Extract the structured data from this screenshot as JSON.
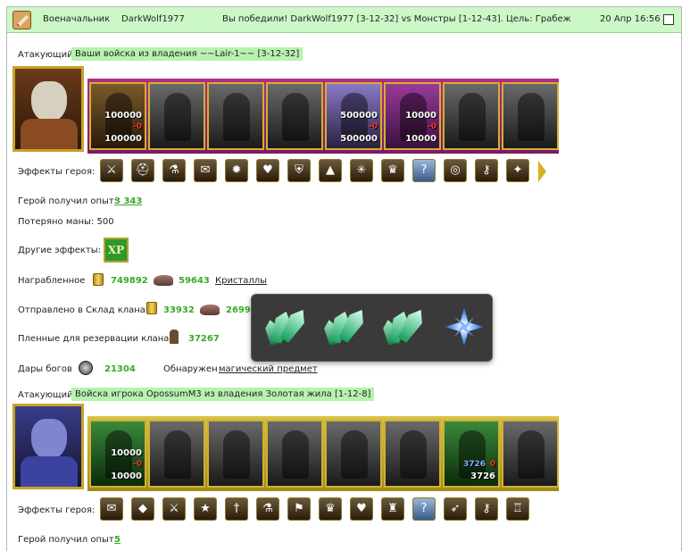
{
  "header": {
    "role": "Военачальник",
    "player": "DarkWolf1977",
    "battle_text": "Вы победили! DarkWolf1977 [3-12-32] vs Монстры [1-12-43]. Цель: Грабеж",
    "datetime": "20 Апр 16:56"
  },
  "section1": {
    "attacker_label": "Атакующий",
    "army_title": "Ваши войска из владения ~~Lair-1~~ [3-12-32]",
    "units": [
      {
        "start": "100000",
        "loss": "-0",
        "end": "100000"
      },
      {
        "start": "",
        "loss": "",
        "end": ""
      },
      {
        "start": "",
        "loss": "",
        "end": ""
      },
      {
        "start": "",
        "loss": "",
        "end": ""
      },
      {
        "start": "500000",
        "loss": "-0",
        "end": "500000"
      },
      {
        "start": "10000",
        "loss": "-0",
        "end": "10000"
      },
      {
        "start": "",
        "loss": "",
        "end": ""
      },
      {
        "start": "",
        "loss": "",
        "end": ""
      }
    ],
    "effects_label": "Эффекты героя:",
    "effects": [
      "sword-icon",
      "helmet-icon",
      "potion-icon",
      "scroll-icon",
      "fire-icon",
      "heart-icon",
      "shield-icon",
      "tent-icon",
      "web-icon",
      "crown-icon",
      "question-icon",
      "ring-icon",
      "key-icon",
      "wand-icon"
    ],
    "exp_label": "Герой получил опыт:",
    "exp_value": "3 343",
    "mana_text": "Потеряно маны: 500",
    "other_effects_label": "Другие эффекты:",
    "xp_badge": "XP",
    "loot_label": "Награбленное",
    "loot_gold": "749892",
    "loot_ore": "59643",
    "loot_link": "Кристаллы",
    "clan_label": "Отправлено в Склад клана",
    "clan_gold": "33932",
    "clan_ore": "2699",
    "prisoners_label": "Пленные для резервации клана:",
    "prisoners_value": "37267",
    "gods_label": "Дары богов",
    "gods_value": "21304",
    "found_label": "Обнаружен",
    "found_link": "магический предмет"
  },
  "section2": {
    "attacker_label": "Атакующий",
    "army_title": "Войска игрока OpossumM3 из владения Золотая жила [1-12-8]",
    "units": [
      {
        "start": "10000",
        "loss": "-0",
        "end": "10000",
        "cur": ""
      },
      {
        "start": "",
        "loss": "",
        "end": "",
        "cur": ""
      },
      {
        "start": "",
        "loss": "",
        "end": "",
        "cur": ""
      },
      {
        "start": "",
        "loss": "",
        "end": "",
        "cur": ""
      },
      {
        "start": "",
        "loss": "",
        "end": "",
        "cur": ""
      },
      {
        "start": "",
        "loss": "",
        "end": "",
        "cur": ""
      },
      {
        "start": "",
        "loss": "0",
        "end": "3726",
        "cur": "3726"
      },
      {
        "start": "",
        "loss": "",
        "end": "",
        "cur": ""
      }
    ],
    "effects_label": "Эффекты героя:",
    "effects": [
      "scroll-icon",
      "gem-icon",
      "sword-icon",
      "star-icon",
      "dagger-icon",
      "potion-icon",
      "banner-icon",
      "crown-icon",
      "heart-icon",
      "castle-icon",
      "question-icon",
      "arrow-icon",
      "key-icon",
      "tower-icon"
    ],
    "exp_label": "Герой получил опыт:",
    "exp_value": "5"
  },
  "tooltip": {
    "items": [
      "green-crystal-icon",
      "green-crystal-icon",
      "green-crystal-icon",
      "blue-star-crystal-icon"
    ]
  },
  "colors": {
    "header_bg": "#ccf8c8",
    "highlight_bg": "#b8f2b0",
    "value_green": "#3aa82a",
    "strip_purple": "#9b2a7a",
    "strip_gold": "#c8b02a"
  }
}
